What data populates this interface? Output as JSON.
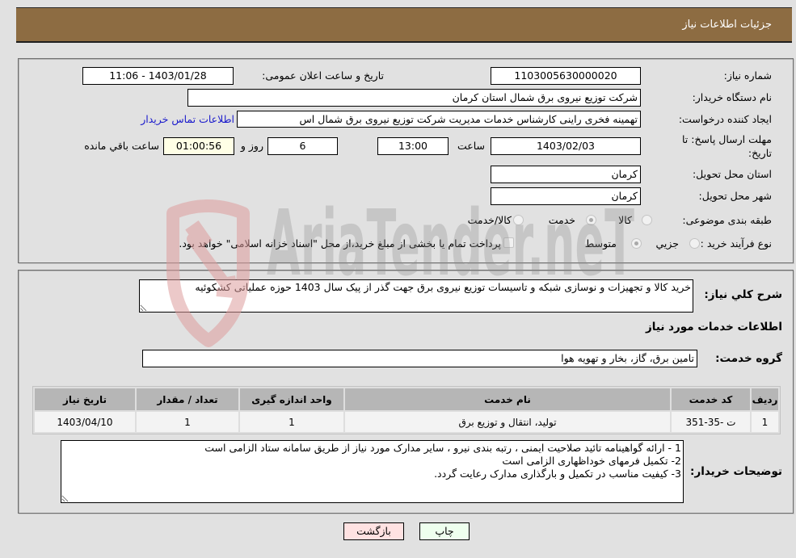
{
  "header": {
    "title": "جزئیات اطلاعات نیاز"
  },
  "details": {
    "need_number": {
      "label": "شماره نیاز:",
      "value": "1103005630000020"
    },
    "announce_datetime": {
      "label": "تاریخ و ساعت اعلان عمومی:",
      "value": "1403/01/28 - 11:06"
    },
    "buyer_org": {
      "label": "نام دستگاه خریدار:",
      "value": "شرکت توزیع نیروی برق شمال استان کرمان"
    },
    "requester": {
      "label": "ایجاد کننده درخواست:",
      "value": "تهمینه فخری راینی کارشناس خدمات مدیریت شرکت توزیع نیروی برق شمال اس",
      "contact_link": "اطلاعات تماس خریدار"
    },
    "deadline": {
      "label_line1": "مهلت ارسال پاسخ: تا",
      "label_line2": "تاریخ:",
      "date": "1403/02/03",
      "time_label": "ساعت",
      "time": "13:00",
      "days": "6",
      "days_label": "روز و",
      "remaining": "01:00:56",
      "remaining_label": "ساعت باقي مانده"
    },
    "province": {
      "label": "استان محل تحویل:",
      "value": "کرمان"
    },
    "city": {
      "label": "شهر محل تحویل:",
      "value": "کرمان"
    },
    "category": {
      "label": "طبقه بندی موضوعی:",
      "options": [
        "کالا",
        "خدمت",
        "کالا/خدمت"
      ],
      "selected": "خدمت"
    },
    "purchase_type": {
      "label": "نوع فرآیند خرید :",
      "options": [
        "جزيي",
        "متوسط"
      ],
      "selected": "متوسط",
      "treasury_checkbox": {
        "label": "پرداخت تمام یا بخشی از مبلغ خرید،از محل \"اسناد خزانه اسلامی\" خواهد بود.",
        "checked": false
      }
    }
  },
  "description": {
    "label": "شرح کلي نیاز:",
    "value": "خرید کالا و تجهیزات و نوسازی شبکه و تاسیسات توزیع نیروی برق جهت گذر از پیک سال 1403 حوزه عملیاتی کشکوئیه"
  },
  "services": {
    "heading": "اطلاعات خدمات مورد نیاز",
    "group_label": "گروه خدمت:",
    "group_value": "تامین برق، گاز، بخار و تهویه هوا",
    "table": {
      "headers": [
        "ردیف",
        "کد خدمت",
        "نام خدمت",
        "واحد اندازه گیری",
        "تعداد / مقدار",
        "تاریخ نیاز"
      ],
      "rows": [
        [
          "1",
          "ت -35-351",
          "تولید، انتقال و توزیع برق",
          "1",
          "1",
          "1403/04/10"
        ]
      ]
    }
  },
  "buyer_notes": {
    "label": "توضیحات خریدار:",
    "text": "1 - ارائه گواهینامه تائید صلاحیت ایمنی ، رتبه بندی نیرو ، سایر مدارک مورد نیاز از طریق سامانه ستاد الزامی است\n2- تکمیل فرمهای خوداظهاری الزامی است\n3- کیفیت مناسب در تکمیل و بارگذاری مدارک رعایت گردد."
  },
  "buttons": {
    "print": "چاپ",
    "back": "بازگشت"
  },
  "watermark": {
    "text": "AriaTender.neT"
  }
}
